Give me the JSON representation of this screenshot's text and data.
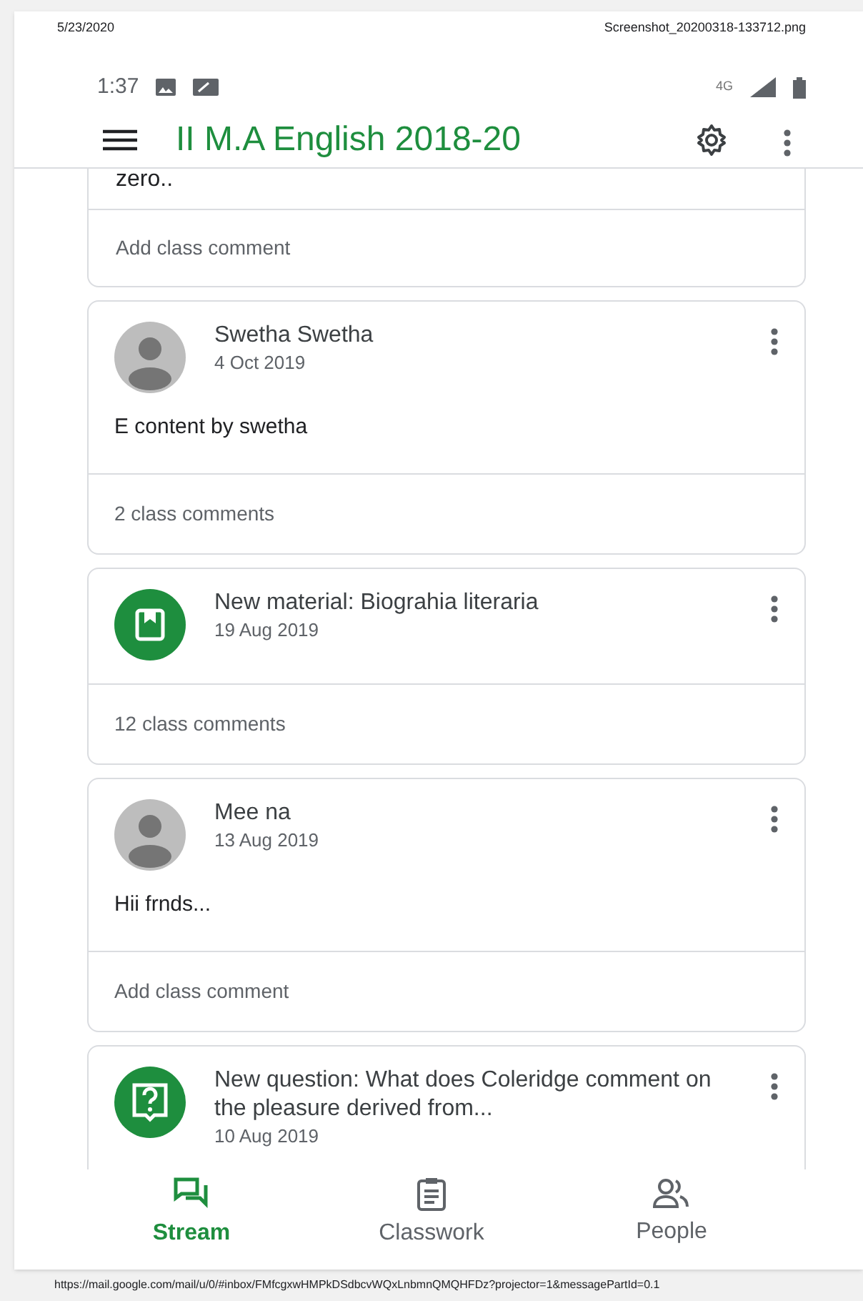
{
  "print_header": {
    "date": "5/23/2020",
    "filename": "Screenshot_20200318-133712.png"
  },
  "status_bar": {
    "time": "1:37",
    "network": "4G"
  },
  "app_bar": {
    "title": "II M.A English 2018-20"
  },
  "posts": [
    {
      "kind": "partial",
      "body": "zero..",
      "comments": "Add class comment"
    },
    {
      "kind": "person",
      "author": "Swetha Swetha",
      "date": "4 Oct 2019",
      "body": "E content by swetha",
      "comments": "2 class comments"
    },
    {
      "kind": "material",
      "author": "New material: Biograhia literaria",
      "date": "19 Aug 2019",
      "comments": "12 class comments"
    },
    {
      "kind": "person",
      "author": "Mee na",
      "date": "13 Aug 2019",
      "body": "Hii  frnds...",
      "comments": "Add class comment"
    },
    {
      "kind": "question",
      "author": "New question: What does Coleridge comment on the pleasure derived from...",
      "date": "10 Aug 2019"
    }
  ],
  "bottom_nav": [
    {
      "label": "Stream",
      "selected": true
    },
    {
      "label": "Classwork",
      "selected": false
    },
    {
      "label": "People",
      "selected": false
    }
  ],
  "print_footer": {
    "url": "https://mail.google.com/mail/u/0/#inbox/FMfcgxwHMPkDSdbcvWQxLnbmnQMQHFDz?projector=1&messagePartId=0.1"
  }
}
